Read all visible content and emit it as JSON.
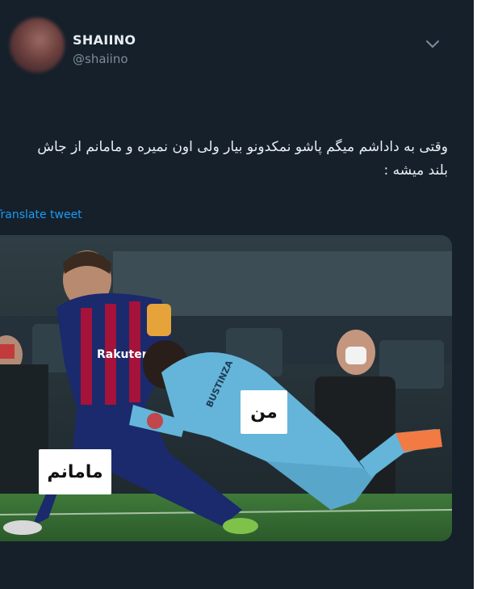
{
  "tweet": {
    "display_name": "SHAIINO",
    "handle": "@shaiino",
    "text": "وقتی به داداشم میگم پاشو نمکدونو بیار ولی اون نمیره و مامانم از جاش بلند میشه :",
    "translate_label": "Translate tweet"
  },
  "media": {
    "caption_top": "من",
    "caption_bottom": "مامانم",
    "jersey_sponsor": "Rakuten",
    "keeper_name": "BUSTINZA"
  },
  "icons": {
    "menu": "chevron-down-icon"
  },
  "colors": {
    "background": "#15202b",
    "link": "#1d9bf0",
    "secondary_text": "#7f8b97"
  }
}
